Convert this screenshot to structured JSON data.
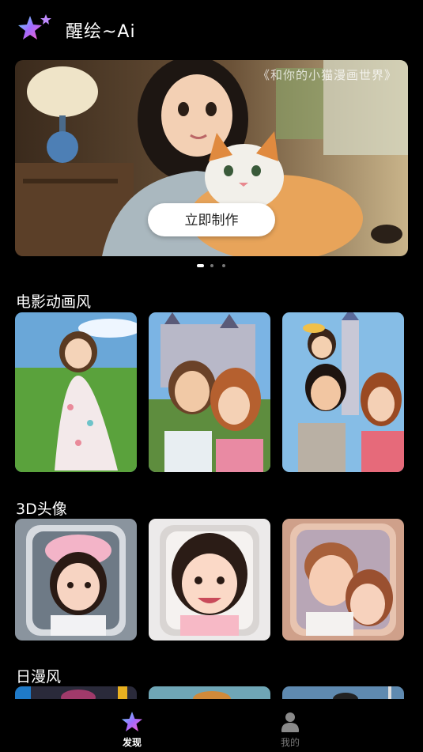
{
  "app": {
    "title": "醒绘~Ai"
  },
  "banner": {
    "caption": "《和你的小猫漫画世界》",
    "cta_label": "立即制作",
    "slide_count": 3,
    "active_slide": 1
  },
  "sections": [
    {
      "title": "电影动画风"
    },
    {
      "title": "3D头像"
    },
    {
      "title": "日漫风"
    }
  ],
  "nav": {
    "discover_label": "发现",
    "mine_label": "我的"
  },
  "colors": {
    "background": "#000000",
    "text": "#ffffff",
    "inactive": "#777777"
  }
}
